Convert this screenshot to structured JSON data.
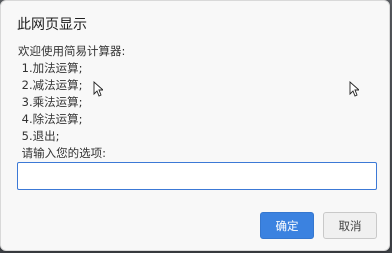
{
  "dialog": {
    "title": "此网页显示",
    "message_lines": [
      "欢迎使用简易计算器:",
      " 1.加法运算;",
      " 2.减法运算;",
      " 3.乘法运算;",
      " 4.除法运算;",
      " 5.退出;",
      " 请输入您的选项:"
    ],
    "input": {
      "value": "",
      "placeholder": ""
    },
    "buttons": {
      "ok": "确定",
      "cancel": "取消"
    }
  },
  "colors": {
    "accent": "#3b82e0",
    "input_border": "#3c79d6"
  },
  "icons": [
    "mouse-pointer-icon",
    "mouse-pointer-icon"
  ]
}
